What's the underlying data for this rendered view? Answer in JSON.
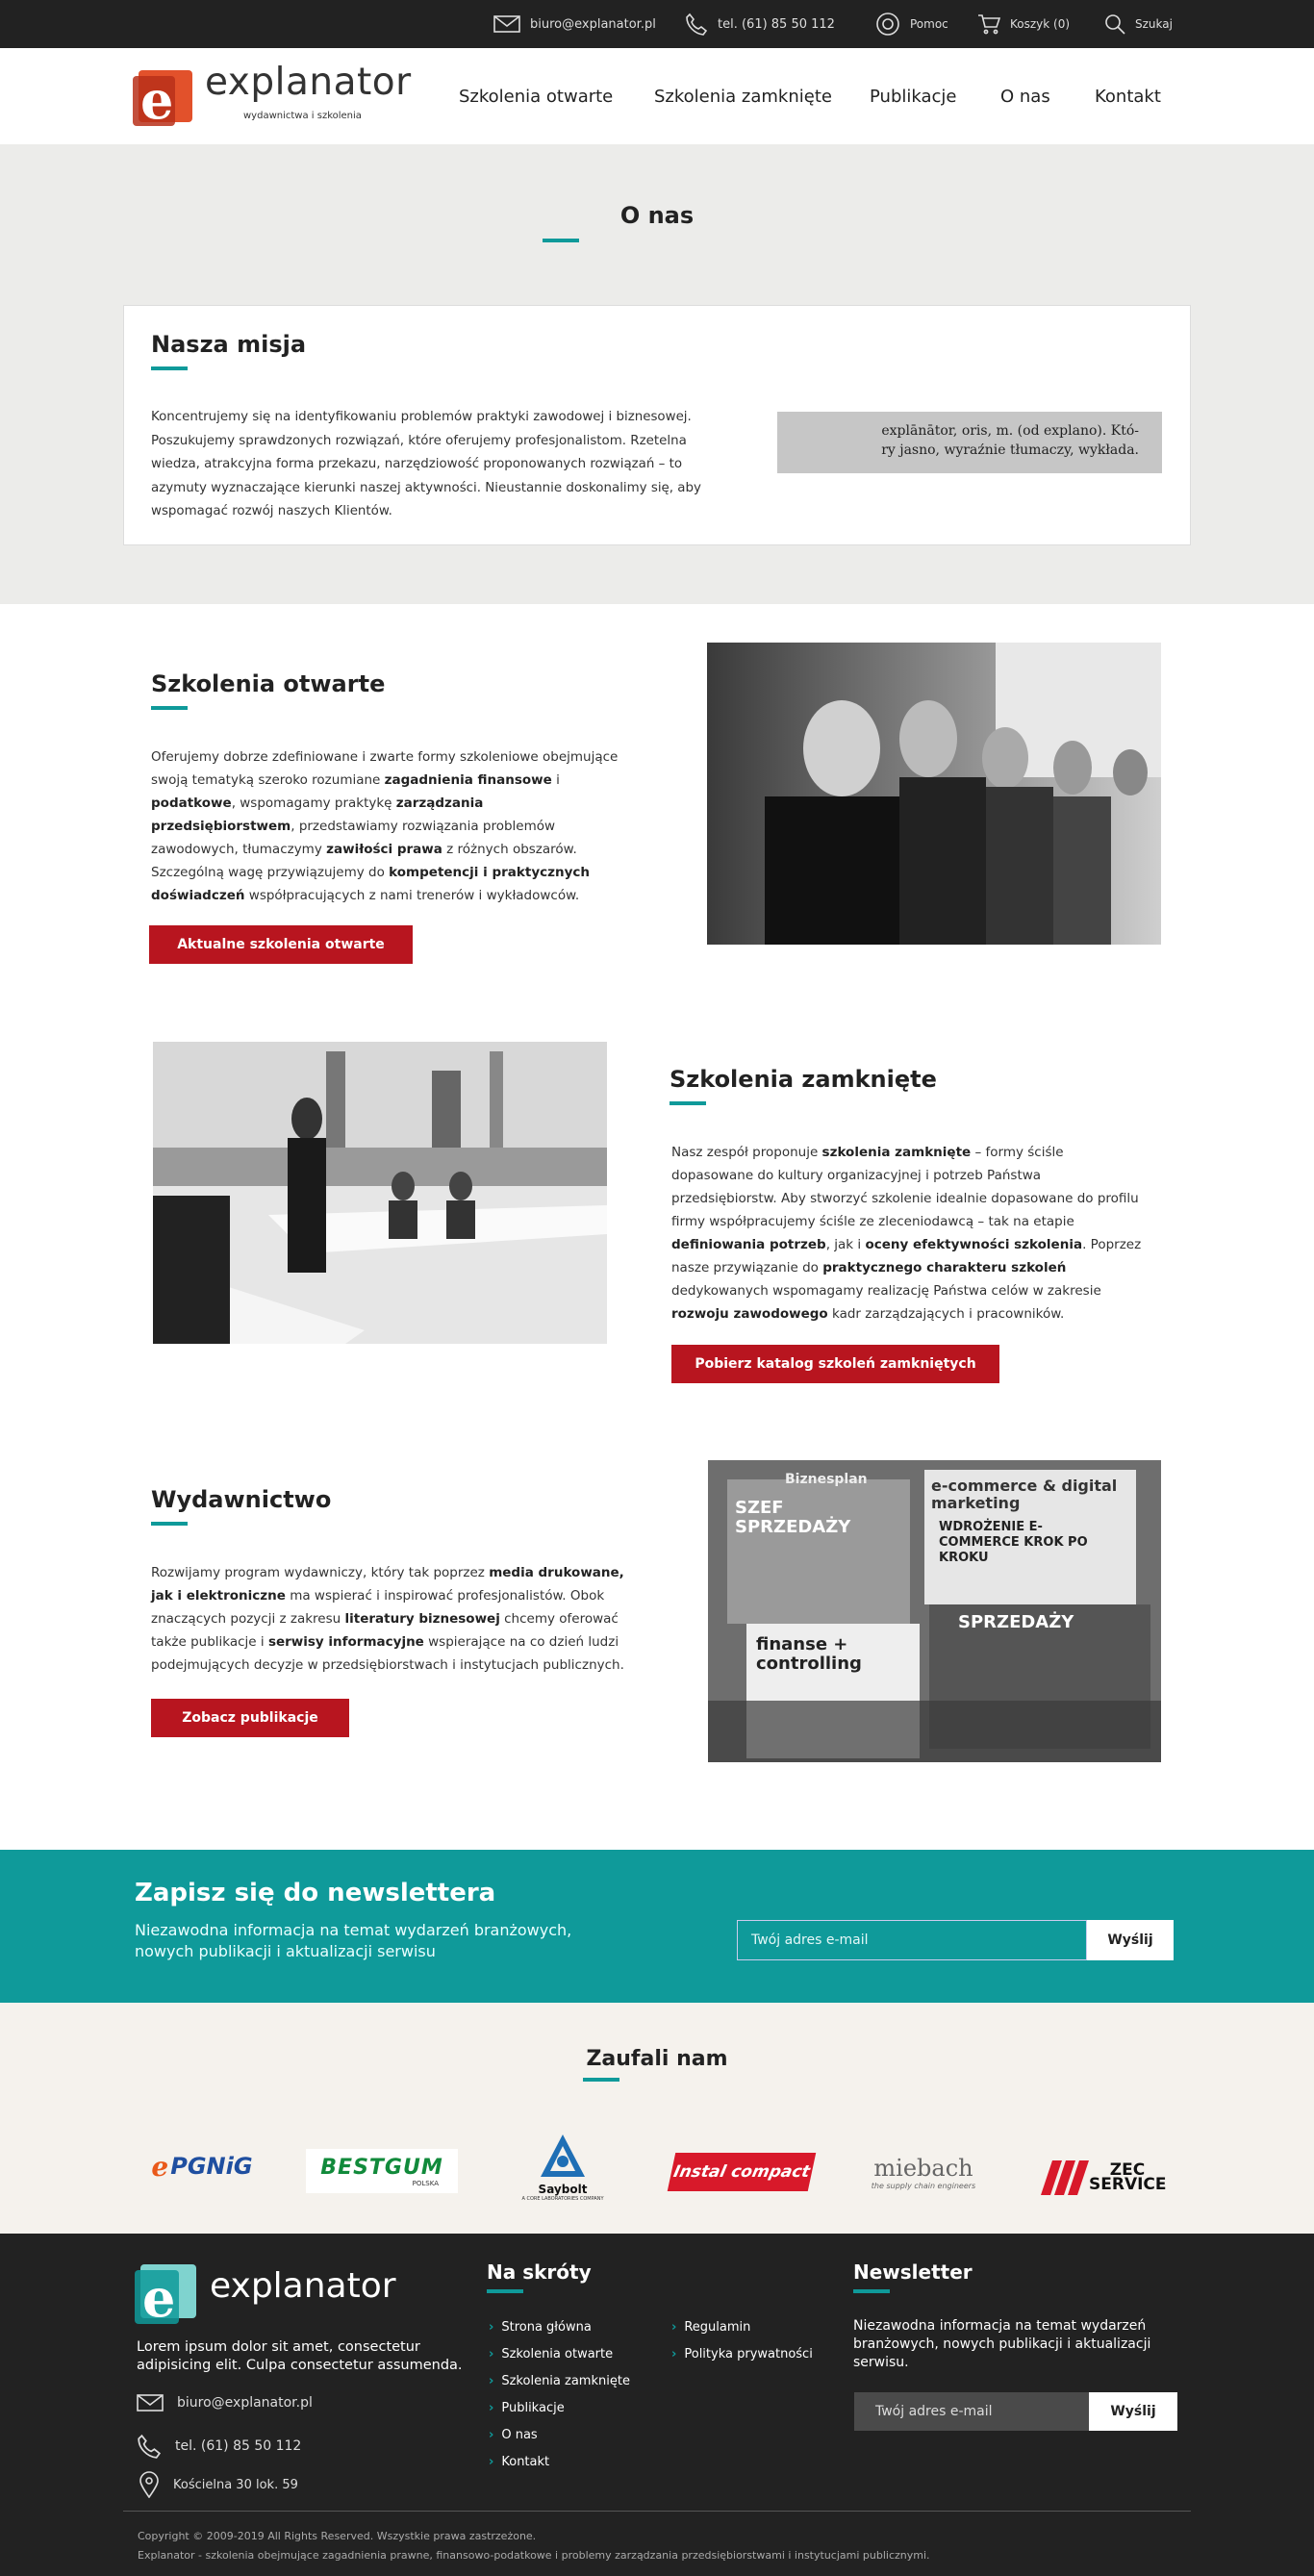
{
  "topbar": {
    "email": "biuro@explanator.pl",
    "phone": "tel. (61) 85 50 112",
    "help": "Pomoc",
    "cart": "Koszyk (0)",
    "search": "Szukaj"
  },
  "header": {
    "logo_word": "explanator",
    "logo_tagline": "wydawnictwa i szkolenia",
    "nav": [
      "Szkolenia otwarte",
      "Szkolenia zamknięte",
      "Publikacje",
      "O nas",
      "Kontakt"
    ]
  },
  "hero": {
    "title": "O nas"
  },
  "mission": {
    "title": "Nasza misja",
    "lines": [
      "Koncentrujemy się na identyfikowaniu problemów praktyki zawodowej i biznesowej.",
      "Poszukujemy sprawdzonych rozwiązań, które oferujemy profesjonalistom. Rzetelna",
      "wiedza, atrakcyjna forma przekazu, narzędziowość proponowanych rozwiązań – to",
      "azymuty wyznaczające kierunki naszej aktywności. Nieustannie doskonalimy się, aby",
      "wspomagać rozwój naszych Klientów."
    ],
    "dict_line1": "explānātor, oris, m. (od explano). Któ-",
    "dict_line2": "ry jasno, wyraźnie tłumaczy, wykłada."
  },
  "open": {
    "title": "Szkolenia otwarte",
    "button": "Aktualne szkolenia otwarte",
    "l1": "Oferujemy dobrze zdefiniowane i zwarte formy szkoleniowe obejmujące",
    "l2a": "swoją tematyką szeroko rozumiane ",
    "l2b": "zagadnienia finansowe",
    "l2c": " i",
    "l3a": "podatkowe",
    "l3b": ", wspomagamy praktykę ",
    "l3c": "zarządzania",
    "l4a": "przedsiębiorstwem",
    "l4b": ", przedstawiamy rozwiązania problemów",
    "l5a": "zawodowych, tłumaczymy ",
    "l5b": "zawiłości prawa",
    "l5c": " z różnych obszarów.",
    "l6a": "Szczególną wagę przywiązujemy do ",
    "l6b": "kompetencji i praktycznych",
    "l7a": "doświadczeń",
    "l7b": " współpracujących z nami trenerów i wykładowców."
  },
  "closed": {
    "title": "Szkolenia zamknięte",
    "button": "Pobierz katalog szkoleń zamkniętych",
    "l1a": "Nasz zespół proponuje ",
    "l1b": "szkolenia zamknięte",
    "l1c": " – formy ściśle",
    "l2": "dopasowane do kultury organizacyjnej i potrzeb Państwa",
    "l3": "przedsiębiorstw. Aby stworzyć szkolenie idealnie dopasowane do profilu",
    "l4": "firmy współpracujemy ściśle ze zleceniodawcą – tak na etapie",
    "l5a": "definiowania potrzeb",
    "l5b": ", jak i ",
    "l5c": "oceny efektywności szkolenia",
    "l5d": ". Poprzez",
    "l6a": "nasze przywiązanie do ",
    "l6b": "praktycznego charakteru szkoleń",
    "l7": "dedykowanych wspomagamy realizację Państwa celów w zakresie",
    "l8a": "rozwoju zawodowego",
    "l8b": " kadr zarządzających i pracowników."
  },
  "publishing": {
    "title": "Wydawnictwo",
    "button": "Zobacz publikacje",
    "l1a": "Rozwijamy program wydawniczy, który tak poprzez ",
    "l1b": "media drukowane,",
    "l2a": "jak i elektroniczne",
    "l2b": " ma wspierać i inspirować profesjonalistów. Obok",
    "l3a": "znaczących pozycji z zakresu ",
    "l3b": "literatury biznesowej",
    "l3c": " chcemy oferować",
    "l4a": "także publikacje i ",
    "l4b": "serwisy informacyjne",
    "l4c": " wspierające na co dzień ludzi",
    "l5": "podejmujących decyzje w przedsiębiorstwach i instytucjach publicznych.",
    "mag1": "SZEF SPRZEDAŻY",
    "mag2": "e-commerce & digital marketing",
    "mag3": "WDROŻENIE E-COMMERCE KROK PO KROKU",
    "mag4": "finanse + controlling",
    "mag5": "SPRZEDAŻY",
    "mag6": "Biznesplan"
  },
  "newsletter": {
    "title": "Zapisz się do newslettera",
    "subtitle": "Niezawodna informacja na temat wydarzeń branżowych, nowych publikacji i aktualizacji serwisu",
    "placeholder": "Twój adres e-mail",
    "button": "Wyślij"
  },
  "trusted": {
    "title": "Zaufali nam",
    "brands": [
      "PGNiG",
      "BESTGUM",
      "Saybolt",
      "Instal compact",
      "miebach",
      "ZEC SERVICE"
    ],
    "bestgum_sub": "POLSKA",
    "saybolt_sub": "A CORE LABORATORIES COMPANY",
    "miebach_sub": "the supply chain engineers"
  },
  "footer": {
    "logo_word": "explanator",
    "about": "Lorem ipsum dolor sit amet, consectetur adipisicing elit. Culpa consectetur assumenda.",
    "email": "biuro@explanator.pl",
    "phone": "tel. (61) 85 50 112",
    "address": "Kościelna 30 lok. 59",
    "shortcuts_title": "Na skróty",
    "links_col1": [
      "Strona główna",
      "Szkolenia otwarte",
      "Szkolenia zamknięte",
      "Publikacje",
      "O nas",
      "Kontakt"
    ],
    "links_col2": [
      "Regulamin",
      "Polityka prywatności"
    ],
    "newsletter_title": "Newsletter",
    "newsletter_text": "Niezawodna informacja na temat wydarzeń branżowych, nowych publikacji i aktualizacji serwisu.",
    "placeholder": "Twój adres e-mail",
    "button": "Wyślij",
    "copyright": "Copyright © 2009-2019 All Rights Reserved. Wszystkie prawa zastrzeżone.",
    "disclaimer": "Explanator - szkolenia obejmujące zagadnienia prawne, finansowo-podatkowe i problemy zarządzania przedsiębiorstwami i instytucjami publicznymi."
  },
  "colors": {
    "accent": "#0f9a9a",
    "button_red": "#b8151f",
    "dark": "#222222",
    "logo_orange": "#e2512b"
  }
}
